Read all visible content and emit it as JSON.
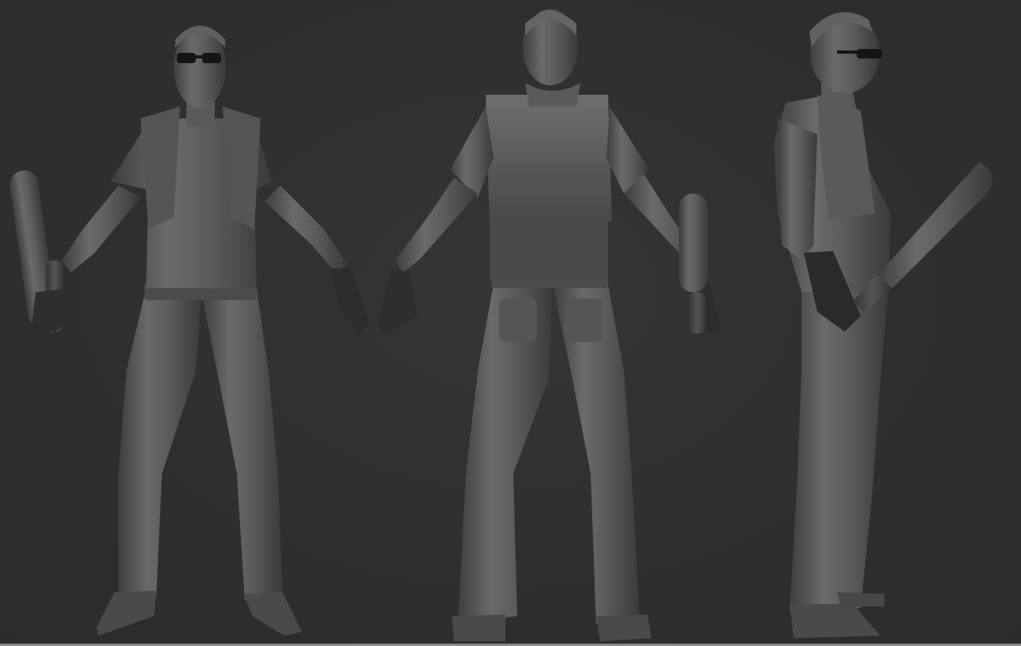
{
  "scene": {
    "background_color": "#2f2f2f",
    "material_color": "#5e5e5e",
    "views": [
      {
        "id": "front",
        "name": "front-view"
      },
      {
        "id": "back",
        "name": "back-view"
      },
      {
        "id": "side",
        "name": "side-view"
      }
    ]
  }
}
